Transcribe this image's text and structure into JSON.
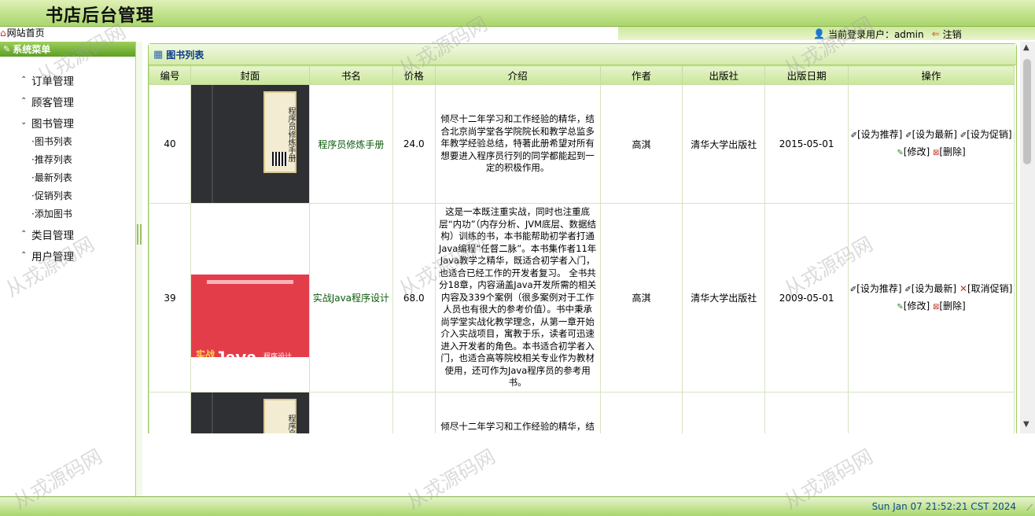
{
  "header": {
    "title": "书店后台管理"
  },
  "nav": {
    "home_icon": "house-icon",
    "home": "网站首页"
  },
  "user": {
    "icon": "user-lock-icon",
    "label": "当前登录用户：admin",
    "logout_icon": "logout-arrow-icon",
    "logout": "注销"
  },
  "sidebar": {
    "title": "系统菜单",
    "groups": [
      {
        "label": "订单管理",
        "expanded": false
      },
      {
        "label": "顾客管理",
        "expanded": false
      },
      {
        "label": "图书管理",
        "expanded": true,
        "items": [
          "·图书列表",
          "·推荐列表",
          "·最新列表",
          "·促销列表",
          "·添加图书"
        ]
      },
      {
        "label": "类目管理",
        "expanded": false
      },
      {
        "label": "用户管理",
        "expanded": false
      }
    ]
  },
  "panel": {
    "title": "图书列表"
  },
  "table": {
    "headers": [
      "编号",
      "封面",
      "书名",
      "价格",
      "介绍",
      "作者",
      "出版社",
      "出版日期",
      "操作"
    ],
    "rows": [
      {
        "id": "40",
        "name": "程序员修炼手册",
        "price": "24.0",
        "intro": "倾尽十二年学习和工作经验的精华，结合北京尚学堂各学院院长和教学总监多年教学经验总结，特著此册希望对所有想要进入程序员行列的同学都能起到一定的积极作用。",
        "author": "高淇",
        "publisher": "清华大学出版社",
        "date": "2015-05-01",
        "ops": [
          "[设为推荐]",
          "[设为最新]",
          "[设为促销]",
          "[修改]",
          "[删除]"
        ]
      },
      {
        "id": "39",
        "name": "实战Java程序设计",
        "price": "68.0",
        "intro": "这是一本既注重实战，同时也注重底层“内功”（内存分析、JVM底层、数据结构）训练的书，本书能帮助初学者打通Java编程“任督二脉”。本书集作者11年Java教学之精华，既适合初学者入门，也适合已经工作的开发者复习。 全书共分18章，内容涵盖Java开发所需的相关内容及339个案例（很多案例对于工作人员也有很大的参考价值）。书中秉承尚学堂实战化教学理念，从第一章开始介入实战项目，寓教于乐，读者可迅速进入开发者的角色。本书适合初学者入门，也适合高等院校相关专业作为教材使用，还可作为Java程序员的参考用书。",
        "author": "高淇",
        "publisher": "清华大学出版社",
        "date": "2009-05-01",
        "ops": [
          "[设为推荐]",
          "[设为最新]",
          "[取消促销]",
          "[修改]",
          "[删除]"
        ]
      },
      {
        "id": "",
        "name": "",
        "price": "",
        "intro": "倾尽十二年学习和工作经验的精华，结",
        "author": "",
        "publisher": "",
        "date": "",
        "ops": []
      }
    ]
  },
  "covers": {
    "book1": [
      "程序员修炼手册"
    ],
    "book2": {
      "logo": "Java",
      "sub": "程序设计",
      "prefix": "实战"
    }
  },
  "footer": {
    "clock": "Sun Jan 07 21:52:21 CST 2024"
  },
  "watermark": "从戎源码网",
  "colors": {
    "header": "#a9d66b",
    "sidebar_head": "#5d9f23",
    "title_blue": "#0a3b8c"
  }
}
